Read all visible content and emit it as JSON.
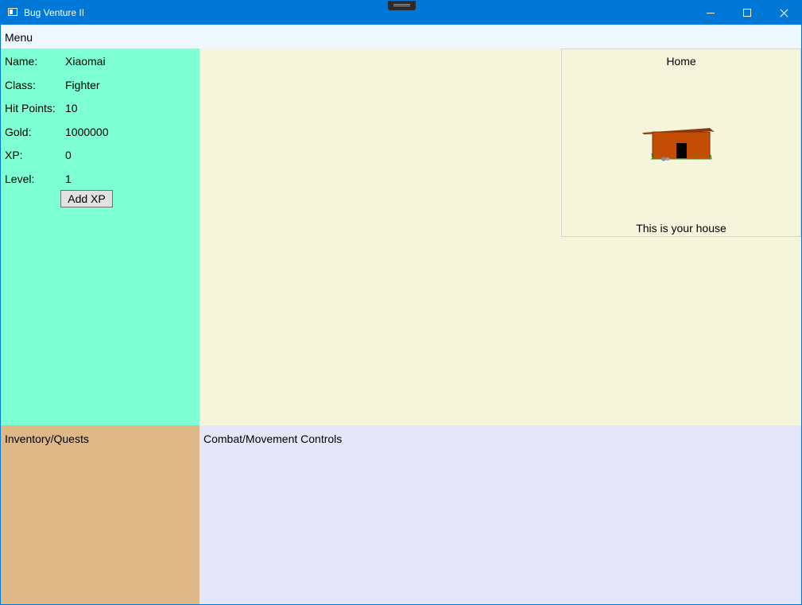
{
  "window": {
    "title": "Bug Venture II"
  },
  "menu": {
    "label": "Menu"
  },
  "player": {
    "stats": [
      {
        "label": "Name:",
        "value": "Xiaomai"
      },
      {
        "label": "Class:",
        "value": "Fighter"
      },
      {
        "label": "Hit Points:",
        "value": "10"
      },
      {
        "label": "Gold:",
        "value": "1000000"
      },
      {
        "label": "XP:",
        "value": "0"
      },
      {
        "label": "Level:",
        "value": "1"
      }
    ],
    "add_xp_label": "Add XP"
  },
  "location": {
    "name": "Home",
    "description": "This is your house",
    "image_icon": "house-icon"
  },
  "panels": {
    "inventory_label": "Inventory/Quests",
    "controls_label": "Combat/Movement Controls"
  },
  "colors": {
    "titlebar": "#0078d7",
    "menubar": "#f0f8ff",
    "stats_panel": "#7fffd4",
    "game_panel": "#f5f5dc",
    "inventory_panel": "#deb887",
    "controls_panel": "#e6e6fa"
  }
}
